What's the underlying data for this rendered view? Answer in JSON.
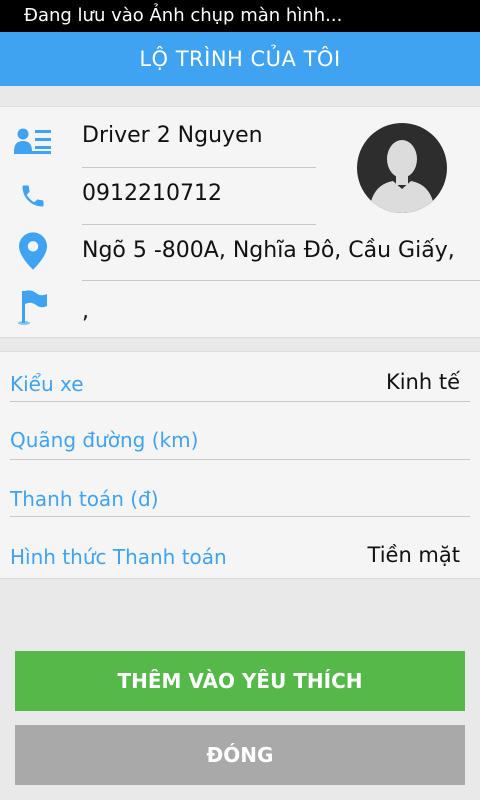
{
  "status_bar": {
    "text": "Đang lưu vào Ảnh chụp màn hình..."
  },
  "header": {
    "title": "LỘ TRÌNH CỦA TÔI"
  },
  "driver": {
    "name": "Driver 2 Nguyen",
    "phone": "0912210712",
    "pickup_address": "Ngõ 5 -800A, Nghĩa Đô, Cầu Giấy,",
    "destination_address": ",",
    "icons": {
      "name": "contact-card-icon",
      "phone": "phone-icon",
      "pickup": "location-pin-icon",
      "destination": "flag-icon",
      "avatar": "user-silhouette"
    }
  },
  "trip": {
    "vehicle_type": {
      "label": "Kiểu xe",
      "value": "Kinh tế"
    },
    "distance": {
      "label": "Quãng đường (km)",
      "value": ""
    },
    "payment_amount": {
      "label": "Thanh toán (đ)",
      "value": ""
    },
    "payment_method": {
      "label": "Hình thức Thanh toán",
      "value": "Tiền mặt"
    }
  },
  "actions": {
    "add_favorite": "THÊM VÀO YÊU THÍCH",
    "close": "ĐÓNG"
  },
  "colors": {
    "accent_blue": "#3fa3f1",
    "button_green": "#55b94a",
    "button_gray": "#a9a9a9",
    "status_bar_bg": "#000000"
  }
}
